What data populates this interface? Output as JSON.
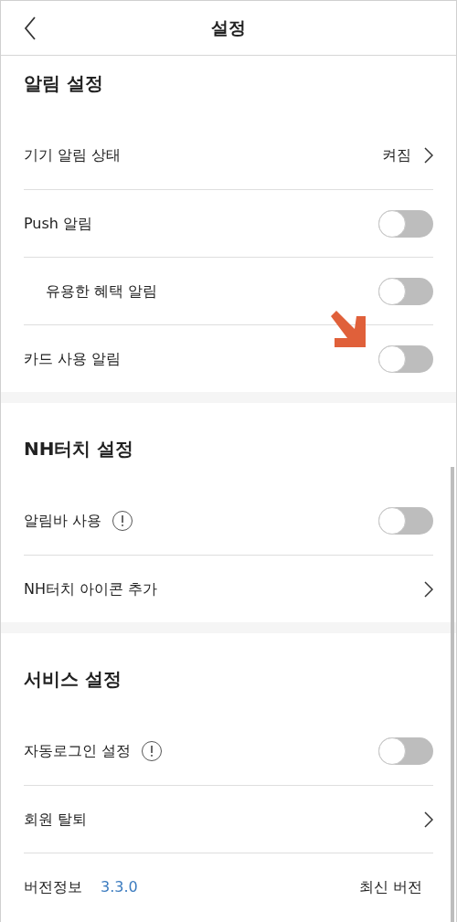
{
  "header": {
    "title": "설정"
  },
  "sections": [
    {
      "title": "알림 설정",
      "rows": [
        {
          "kind": "link",
          "label": "기기 알림 상태",
          "value": "켜짐"
        },
        {
          "kind": "toggle",
          "label": "Push 알림",
          "on": false,
          "children": [
            {
              "kind": "toggle",
              "label": "유용한 혜택 알림",
              "on": false
            }
          ]
        },
        {
          "kind": "toggle",
          "label": "카드 사용 알림",
          "on": false,
          "pointer": true
        }
      ]
    },
    {
      "title": "NH터치 설정",
      "rows": [
        {
          "kind": "toggle",
          "label": "알림바 사용",
          "info": true,
          "on": false
        },
        {
          "kind": "link",
          "label": "NH터치 아이콘 추가"
        }
      ]
    },
    {
      "title": "서비스 설정",
      "rows": [
        {
          "kind": "toggle",
          "label": "자동로그인 설정",
          "info": true,
          "on": false
        },
        {
          "kind": "link",
          "label": "회원 탈퇴"
        },
        {
          "kind": "version",
          "label": "버전정보",
          "version": "3.3.0",
          "value": "최신 버전"
        }
      ]
    }
  ]
}
